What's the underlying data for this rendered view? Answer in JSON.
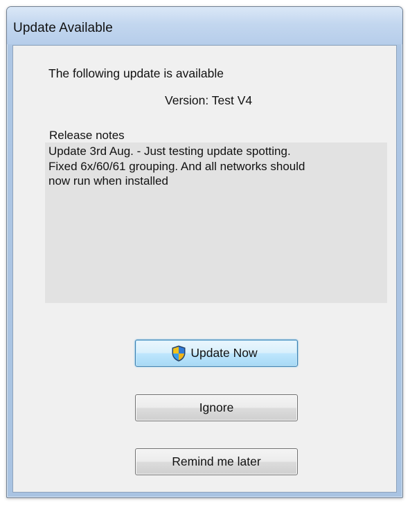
{
  "window": {
    "title": "Update Available"
  },
  "content": {
    "headline": "The following update is available",
    "version_text": "Version: Test V4",
    "release_notes_label": "Release notes",
    "release_notes_lines": [
      "Update 3rd Aug. - Just testing update spotting.",
      "Fixed 6x/60/61 grouping. And all networks should",
      "now run when installed"
    ]
  },
  "buttons": {
    "update_now": "Update Now",
    "ignore": "Ignore",
    "remind_later": "Remind me later"
  },
  "icons": {
    "update_button_icon": "uac-shield-icon"
  },
  "colors": {
    "client_background": "#f0f0f0",
    "notes_background": "#e2e2e2",
    "default_button_border": "#3c7fb1"
  }
}
